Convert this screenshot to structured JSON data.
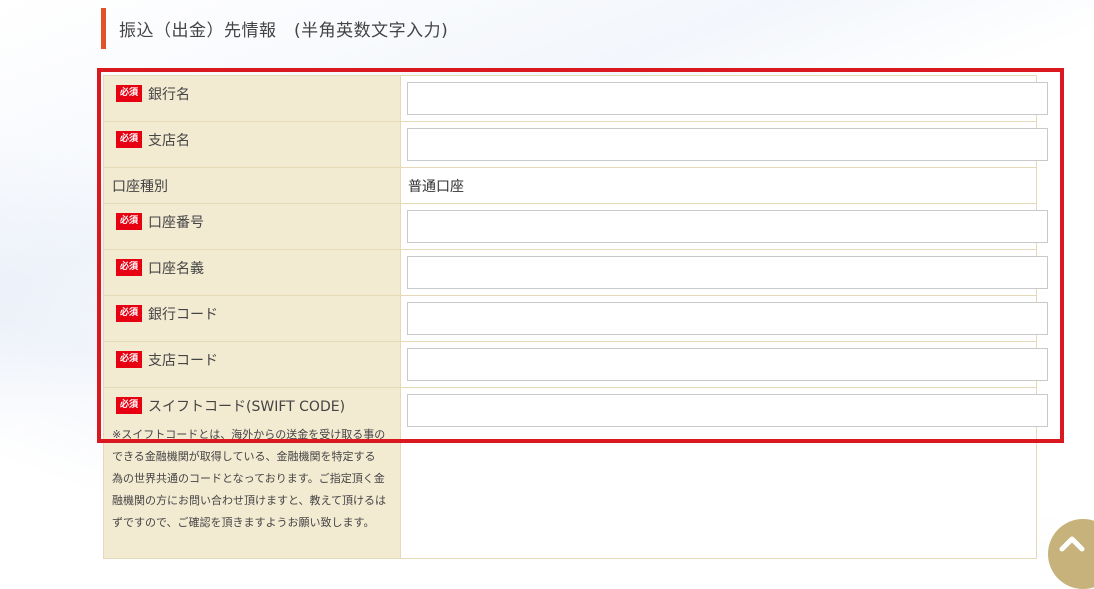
{
  "section": {
    "title": "振込（出金）先情報　(半角英数文字入力)"
  },
  "required_badge": "必須",
  "fields": {
    "bank_name": {
      "label": "銀行名"
    },
    "branch_name": {
      "label": "支店名"
    },
    "account_type": {
      "label": "口座種別",
      "value": "普通口座"
    },
    "account_number": {
      "label": "口座番号"
    },
    "account_holder": {
      "label": "口座名義"
    },
    "bank_code": {
      "label": "銀行コード"
    },
    "branch_code": {
      "label": "支店コード"
    },
    "swift_code": {
      "label": "スイフトコード(SWIFT CODE)",
      "note": "※スイフトコードとは、海外からの送金を受け取る事のできる金融機関が取得している、金融機関を特定する為の世界共通のコードとなっております。ご指定頂く金融機関の方にお問い合わせ頂けますと、教えて頂けるはずですので、ご確認を頂きますようお願い致します。"
    }
  },
  "colors": {
    "accent": "#e0522a",
    "required": "#e60012",
    "label_bg": "#f3ead2",
    "highlight": "#d9191f",
    "scroll_button": "#c6b27a"
  },
  "icons": {
    "scroll_top": "chevron-up-icon"
  }
}
